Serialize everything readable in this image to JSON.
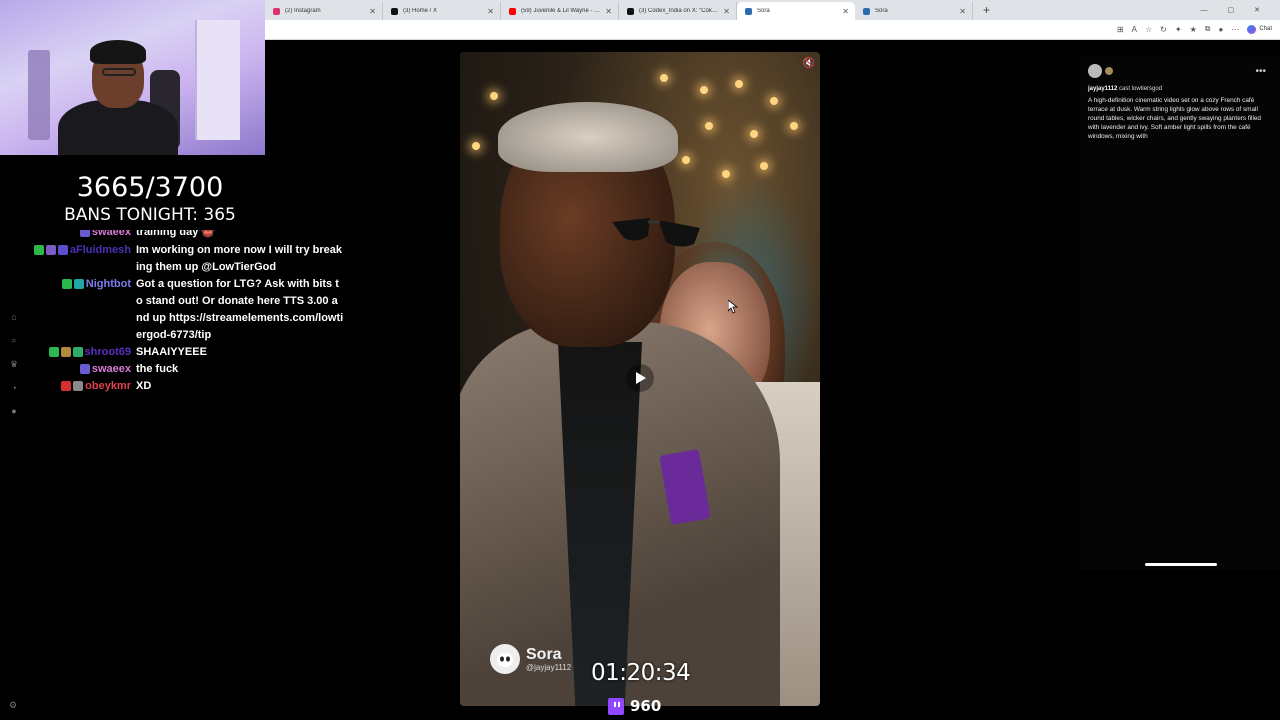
{
  "browser": {
    "tabs": [
      {
        "label": "(2) Instagram",
        "color": "#e1306c",
        "active": false
      },
      {
        "label": "(3) Home / X",
        "color": "#111111",
        "active": false
      },
      {
        "label": "(59) Juvenile & Lil Wayne - Bling B",
        "color": "#ff0000",
        "active": false
      },
      {
        "label": "(3) Codex_India on X: \"Coke infero",
        "color": "#111111",
        "active": false
      },
      {
        "label": "Sora",
        "color": "#2b6cb0",
        "active": true
      },
      {
        "label": "Sora",
        "color": "#2b6cb0",
        "active": false
      }
    ],
    "chat_button": "Chat"
  },
  "counter": {
    "value": "3665/3700",
    "bans": "Bans tonight: 365"
  },
  "chat": {
    "messages": [
      {
        "user": "swaeex",
        "user_color": "#d67bd6",
        "text": "training day 👹",
        "badges": [
          "#6b5bd1"
        ],
        "cut": true
      },
      {
        "user": "aFluidmesh",
        "user_color": "#4b2fb5",
        "text": "Im working on more now I will try breaking them up @LowTierGod",
        "badges": [
          "#2db84d",
          "#7a5cc4",
          "#5a4fcf"
        ]
      },
      {
        "user": "Nightbot",
        "user_color": "#7d7df0",
        "text": "Got a question for LTG? Ask with bits to stand out! Or donate here TTS 3.00 and up https://streamelements.com/lowtiergod-6773/tip",
        "badges": [
          "#2db84d",
          "#22a6a6"
        ]
      },
      {
        "user": "shroot69",
        "user_color": "#5a2fc0",
        "text": "SHAAIYYEEE",
        "badges": [
          "#2db84d",
          "#b08a3a",
          "#2fae6a"
        ]
      },
      {
        "user": "swaeex",
        "user_color": "#d67bd6",
        "text": "the fuck",
        "badges": [
          "#6b5bd1"
        ]
      },
      {
        "user": "obeykmr",
        "user_color": "#e0414b",
        "text": "XD",
        "badges": [
          "#d62f2f",
          "#8a8a8a"
        ]
      }
    ]
  },
  "video": {
    "brand": "Sora",
    "handle": "@jayjay1112"
  },
  "stream": {
    "timer": "01:20:34",
    "viewers": "960"
  },
  "side": {
    "user": "jayjay1112",
    "cast": "cast lowtiersgod",
    "description": "A high-definition cinematic video set on a cozy French café terrace at dusk. Warm string lights glow above rows of small round tables, wicker chairs, and gently swaying planters filled with lavender and ivy. Soft amber light spills from the café windows, mixing with"
  }
}
